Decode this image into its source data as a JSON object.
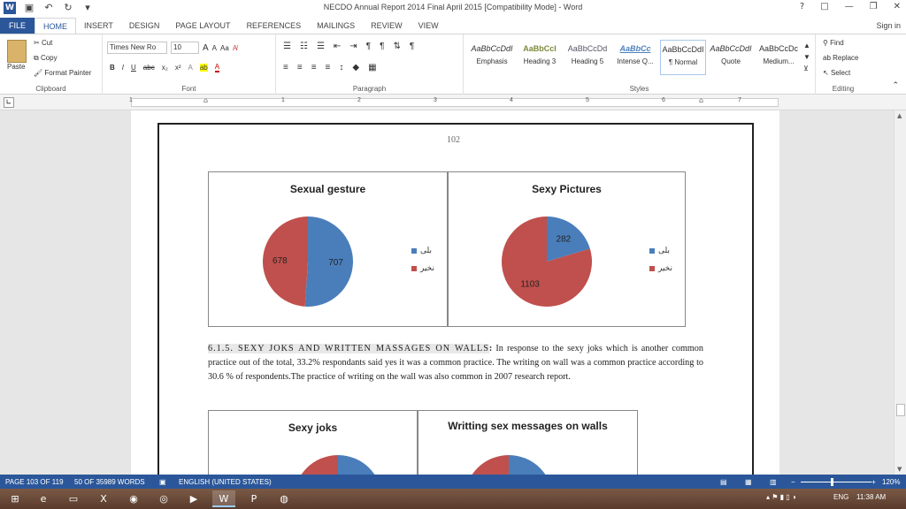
{
  "window": {
    "title": "NECDO Annual Report 2014 Final April 2015 [Compatibility Mode] - Word",
    "controls": [
      "?",
      "□",
      "—",
      "❐",
      "✕"
    ],
    "signin": "Sign in"
  },
  "tabs": [
    "FILE",
    "HOME",
    "INSERT",
    "DESIGN",
    "PAGE LAYOUT",
    "REFERENCES",
    "MAILINGS",
    "REVIEW",
    "VIEW"
  ],
  "clipboard": {
    "paste": "Paste",
    "cut": "Cut",
    "copy": "Copy",
    "format_painter": "Format Painter",
    "label": "Clipboard"
  },
  "font": {
    "name": "Times New Ro",
    "size": "10",
    "label": "Font",
    "grow": "A",
    "shrink": "A",
    "case": "Aa",
    "buttons": [
      "B",
      "I",
      "U",
      "abc",
      "x₂",
      "x²"
    ]
  },
  "paragraph": {
    "label": "Paragraph"
  },
  "styles": {
    "label": "Styles",
    "items": [
      {
        "sample": "AaBbCcDdI",
        "name": "Emphasis"
      },
      {
        "sample": "AaBbCcI",
        "name": "Heading 3"
      },
      {
        "sample": "AaBbCcDd",
        "name": "Heading 5"
      },
      {
        "sample": "AaBbCc",
        "name": "Intense Q..."
      },
      {
        "sample": "AaBbCcDdI",
        "name": "¶ Normal"
      },
      {
        "sample": "AaBbCcDdI",
        "name": "Quote"
      },
      {
        "sample": "AaBbCcDc",
        "name": "Medium..."
      }
    ]
  },
  "editing": {
    "find": "Find",
    "replace": "Replace",
    "select": "Select",
    "label": "Editing"
  },
  "ruler": {
    "numbers": [
      "1",
      "1",
      "2",
      "3",
      "4",
      "5",
      "6",
      "7"
    ]
  },
  "page": {
    "number": "102"
  },
  "colors": {
    "blue": "#4a7ebb",
    "red": "#c0504d",
    "accent": "#2b579a"
  },
  "chart_data": [
    {
      "type": "pie",
      "title": "Sexual gesture",
      "categories": [
        "بلی",
        "نخیر"
      ],
      "values": [
        707,
        678
      ]
    },
    {
      "type": "pie",
      "title": "Sexy Pictures",
      "categories": [
        "بلی",
        "نخیر"
      ],
      "values": [
        282,
        1103
      ]
    },
    {
      "type": "pie",
      "title": "Sexy joks",
      "categories": [],
      "values": []
    },
    {
      "type": "pie",
      "title": "Writting sex messages on walls",
      "categories": [],
      "values": []
    }
  ],
  "paragraph_text": {
    "heading": "6.1.5. SEXY JOKS AND WRITTEN MASSAGES ON WALLS",
    "colon": ":",
    "body": " In response to the sexy joks which is another common practice out of the total, 33.2% respondants said yes it was a common practice. The writing on wall was a common practice according to 30.6 % of respondents.The practice of writing on the wall was also common in 2007 research report."
  },
  "status": {
    "page": "PAGE 103 OF 119",
    "words": "50 OF 35989 WORDS",
    "language": "ENGLISH (UNITED STATES)",
    "zoom": "120%"
  },
  "taskbar": {
    "lang": "ENG",
    "time": "11:38 AM"
  }
}
